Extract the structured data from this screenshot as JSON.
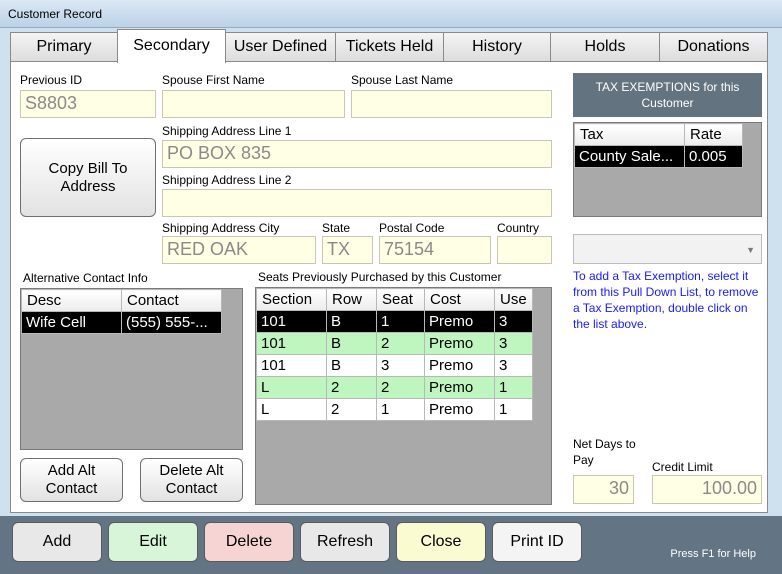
{
  "window": {
    "title": "Customer Record"
  },
  "tabs": [
    "Primary",
    "Secondary",
    "User Defined",
    "Tickets Held",
    "History",
    "Holds",
    "Donations"
  ],
  "active_tab": "Secondary",
  "fields": {
    "previous_id": {
      "label": "Previous ID",
      "value": "S8803"
    },
    "spouse_first": {
      "label": "Spouse First Name",
      "value": ""
    },
    "spouse_last": {
      "label": "Spouse Last Name",
      "value": ""
    },
    "ship1": {
      "label": "Shipping Address Line 1",
      "value": "PO BOX 835"
    },
    "ship2": {
      "label": "Shipping Address Line 2",
      "value": ""
    },
    "city": {
      "label": "Shipping Address City",
      "value": "RED OAK"
    },
    "state": {
      "label": "State",
      "value": "TX"
    },
    "postal": {
      "label": "Postal Code",
      "value": "75154"
    },
    "country": {
      "label": "Country",
      "value": ""
    },
    "net_days": {
      "label": "Net Days to Pay",
      "value": "30"
    },
    "credit_limit": {
      "label": "Credit Limit",
      "value": "100.00"
    }
  },
  "copy_bill_button": "Copy Bill To Address",
  "alt_contact": {
    "label": "Alternative Contact Info",
    "headers": [
      "Desc",
      "Contact"
    ],
    "rows": [
      [
        "Wife Cell",
        "(555) 555-..."
      ]
    ],
    "add_button": "Add Alt Contact",
    "delete_button": "Delete Alt Contact"
  },
  "seats": {
    "label": "Seats Previously Purchased by this Customer",
    "headers": [
      "Section",
      "Row",
      "Seat",
      "Cost",
      "Use"
    ],
    "rows": [
      [
        "101",
        "B",
        "1",
        "Premo",
        "3"
      ],
      [
        "101",
        "B",
        "2",
        "Premo",
        "3"
      ],
      [
        "101",
        "B",
        "3",
        "Premo",
        "3"
      ],
      [
        "L",
        "2",
        "2",
        "Premo",
        "1"
      ],
      [
        "L",
        "2",
        "1",
        "Premo",
        "1"
      ]
    ]
  },
  "tax": {
    "header": "TAX EXEMPTIONS for this Customer",
    "headers": [
      "Tax",
      "Rate"
    ],
    "rows": [
      [
        "County Sale...",
        "0.005"
      ]
    ],
    "dropdown_value": "",
    "hint": "To add a Tax Exemption, select it from this Pull Down List, to remove a Tax Exemption, double click on the list above."
  },
  "bottom_buttons": [
    {
      "label": "Add",
      "color": "#e8e8e8"
    },
    {
      "label": "Edit",
      "color": "#d9f5d9"
    },
    {
      "label": "Delete",
      "color": "#f7d4d4"
    },
    {
      "label": "Refresh",
      "color": "#e8e8e8"
    },
    {
      "label": "Close",
      "color": "#fbfbd2"
    },
    {
      "label": "Print ID",
      "color": "#f4f4f4"
    }
  ],
  "help_text": "Press F1 for Help"
}
